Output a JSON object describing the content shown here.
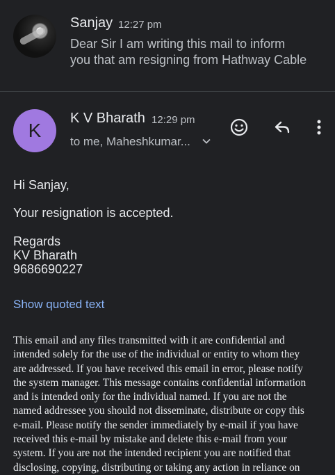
{
  "previous_email": {
    "sender": "Sanjay",
    "time": "12:27 pm",
    "snippet_lines": [
      "Dear Sir I am writing this mail to inform",
      "you that am resigning from Hathway Cable"
    ]
  },
  "current_email": {
    "avatar_letter": "K",
    "sender": "K V Bharath",
    "time": "12:29 pm",
    "recipients": "to me, Maheshkumar...",
    "actions": {
      "emoji_icon": "smiley-icon",
      "reply_icon": "reply-icon",
      "more_icon": "more-vert-icon"
    },
    "body": {
      "greeting": "Hi Sanjay,",
      "message": "Your resignation is accepted.",
      "signoff": "Regards",
      "signature_name": "KV Bharath",
      "signature_phone": "9686690227"
    },
    "show_quoted": "Show quoted text",
    "disclaimer_lines": [
      "This email and any files transmitted with it are confidential and",
      "intended solely for the use of the individual or entity to whom they",
      "are addressed. If you have received this email in error, please notify",
      "the system manager. This message contains confidential information",
      "and is intended only for the individual named. If you are not the",
      "named addressee you should not disseminate, distribute or copy this",
      "e-mail. Please notify the sender immediately by e-mail if you have",
      "received this e-mail by mistake and delete this e-mail from your",
      "system. If you are not the intended recipient you are notified that",
      "disclosing, copying, distributing or taking any action in reliance on"
    ]
  },
  "colors": {
    "background": "#202124",
    "avatar_k": "#a079e0",
    "link": "#8ab4f8"
  }
}
